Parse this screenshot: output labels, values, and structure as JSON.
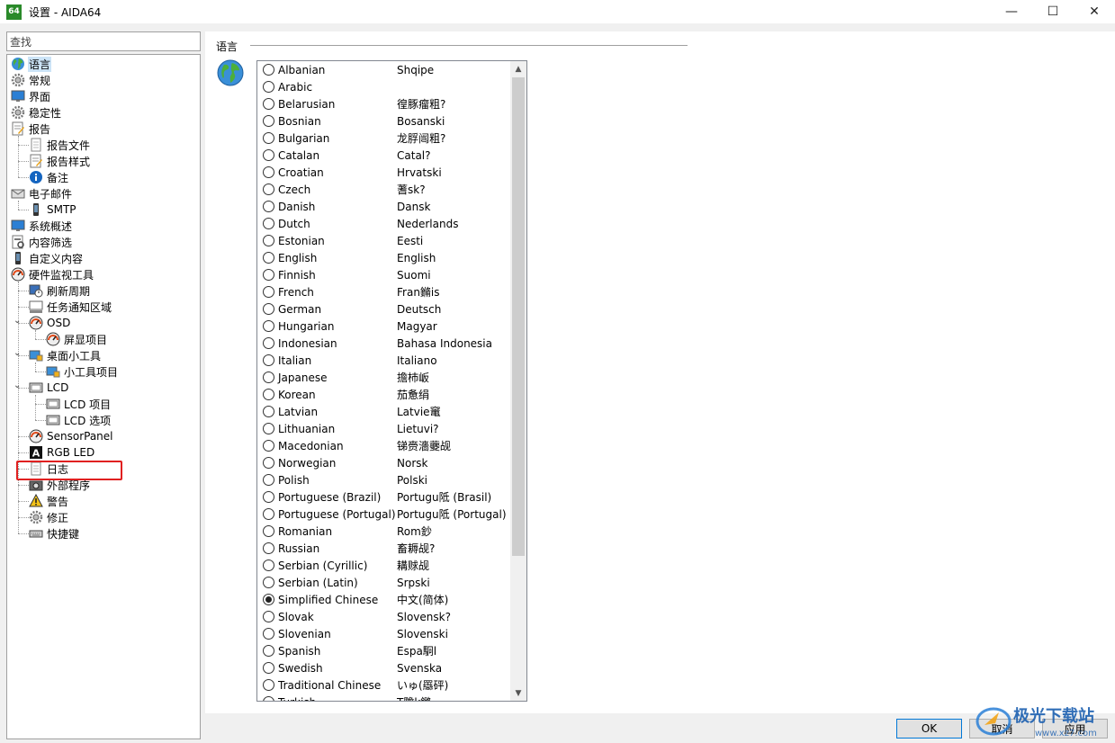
{
  "window": {
    "app_icon_text": "64",
    "title": "设置 - AIDA64",
    "minimize": "—",
    "maximize": "☐",
    "close": "✕"
  },
  "search": {
    "value": "查找"
  },
  "tree": [
    {
      "label": "语言",
      "icon": "globe-icon",
      "level": 0,
      "selected": true
    },
    {
      "label": "常规",
      "icon": "gear-icon",
      "level": 0
    },
    {
      "label": "界面",
      "icon": "monitor-icon",
      "level": 0
    },
    {
      "label": "稳定性",
      "icon": "gear-icon",
      "level": 0
    },
    {
      "label": "报告",
      "icon": "report-icon",
      "level": 0
    },
    {
      "label": "报告文件",
      "icon": "document-icon",
      "level": 1
    },
    {
      "label": "报告样式",
      "icon": "report-icon",
      "level": 1
    },
    {
      "label": "备注",
      "icon": "info-icon",
      "level": 1
    },
    {
      "label": "电子邮件",
      "icon": "email-icon",
      "level": 0
    },
    {
      "label": "SMTP",
      "icon": "phone-icon",
      "level": 1
    },
    {
      "label": "系统概述",
      "icon": "monitor-icon",
      "level": 0
    },
    {
      "label": "内容筛选",
      "icon": "filter-icon",
      "level": 0
    },
    {
      "label": "自定义内容",
      "icon": "phone-icon",
      "level": 0
    },
    {
      "label": "硬件监视工具",
      "icon": "gauge-icon",
      "level": 0
    },
    {
      "label": "刷新周期",
      "icon": "refresh-icon",
      "level": 1
    },
    {
      "label": "任务通知区域",
      "icon": "taskbar-icon",
      "level": 1
    },
    {
      "label": "OSD",
      "icon": "gauge-icon",
      "level": 1,
      "expand": true
    },
    {
      "label": "屏显项目",
      "icon": "gauge-icon",
      "level": 2
    },
    {
      "label": "桌面小工具",
      "icon": "gadget-icon",
      "level": 1,
      "expand": true
    },
    {
      "label": "小工具项目",
      "icon": "gadget-icon",
      "level": 2
    },
    {
      "label": "LCD",
      "icon": "lcd-icon",
      "level": 1,
      "expand": true
    },
    {
      "label": "LCD 项目",
      "icon": "lcd-icon",
      "level": 2
    },
    {
      "label": "LCD 选项",
      "icon": "lcd-icon",
      "level": 2
    },
    {
      "label": "SensorPanel",
      "icon": "gauge-icon",
      "level": 1
    },
    {
      "label": "RGB LED",
      "icon": "rgb-icon",
      "level": 1
    },
    {
      "label": "日志",
      "icon": "document-icon",
      "level": 1
    },
    {
      "label": "外部程序",
      "icon": "camera-icon",
      "level": 1
    },
    {
      "label": "警告",
      "icon": "warning-icon",
      "level": 1
    },
    {
      "label": "修正",
      "icon": "gear-icon",
      "level": 1
    },
    {
      "label": "快捷键",
      "icon": "keyboard-icon",
      "level": 1
    }
  ],
  "section": {
    "title": "语言"
  },
  "languages": [
    {
      "name": "Albanian",
      "native": "Shqipe"
    },
    {
      "name": "Arabic",
      "native": ""
    },
    {
      "name": "Belarusian",
      "native": "徨豚瘤粗?"
    },
    {
      "name": "Bosnian",
      "native": "Bosanski"
    },
    {
      "name": "Bulgarian",
      "native": "龙脬闿粗?"
    },
    {
      "name": "Catalan",
      "native": "Catal?"
    },
    {
      "name": "Croatian",
      "native": "Hrvatski"
    },
    {
      "name": "Czech",
      "native": "蓍sk?"
    },
    {
      "name": "Danish",
      "native": "Dansk"
    },
    {
      "name": "Dutch",
      "native": "Nederlands"
    },
    {
      "name": "Estonian",
      "native": "Eesti"
    },
    {
      "name": "English",
      "native": "English"
    },
    {
      "name": "Finnish",
      "native": "Suomi"
    },
    {
      "name": "French",
      "native": "Fran鏅is"
    },
    {
      "name": "German",
      "native": "Deutsch"
    },
    {
      "name": "Hungarian",
      "native": "Magyar"
    },
    {
      "name": "Indonesian",
      "native": "Bahasa Indonesia"
    },
    {
      "name": "Italian",
      "native": "Italiano"
    },
    {
      "name": "Japanese",
      "native": "擔杮岅"
    },
    {
      "name": "Korean",
      "native": "茄惫绢"
    },
    {
      "name": "Latvian",
      "native": "Latvie竃"
    },
    {
      "name": "Lithuanian",
      "native": "Lietuvi?"
    },
    {
      "name": "Macedonian",
      "native": "锑赍濇虁觇"
    },
    {
      "name": "Norwegian",
      "native": "Norsk"
    },
    {
      "name": "Polish",
      "native": "Polski"
    },
    {
      "name": "Portuguese (Brazil)",
      "native": "Portugu阺 (Brasil)"
    },
    {
      "name": "Portuguese (Portugal)",
      "native": "Portugu阺 (Portugal)"
    },
    {
      "name": "Romanian",
      "native": "Rom鈔"
    },
    {
      "name": "Russian",
      "native": "畜耨觇?"
    },
    {
      "name": "Serbian (Cyrillic)",
      "native": "耩赇觇"
    },
    {
      "name": "Serbian (Latin)",
      "native": "Srpski"
    },
    {
      "name": "Simplified Chinese",
      "native": "中文(简体)",
      "checked": true
    },
    {
      "name": "Slovak",
      "native": "Slovensk?"
    },
    {
      "name": "Slovenian",
      "native": "Slovenski"
    },
    {
      "name": "Spanish",
      "native": "Espa駉l"
    },
    {
      "name": "Swedish",
      "native": "Svenska"
    },
    {
      "name": "Traditional Chinese",
      "native": "いゅ(羉砰)"
    },
    {
      "name": "Turkish",
      "native": "T黵k鏴"
    }
  ],
  "buttons": {
    "ok": "OK",
    "cancel": "取消",
    "apply": "应用"
  },
  "watermark": {
    "text": "极光下载站",
    "url": "www.xz7.com"
  },
  "colors": {
    "accent": "#0078d7",
    "selection": "#cce4f7",
    "highlight_box": "#e02020"
  }
}
